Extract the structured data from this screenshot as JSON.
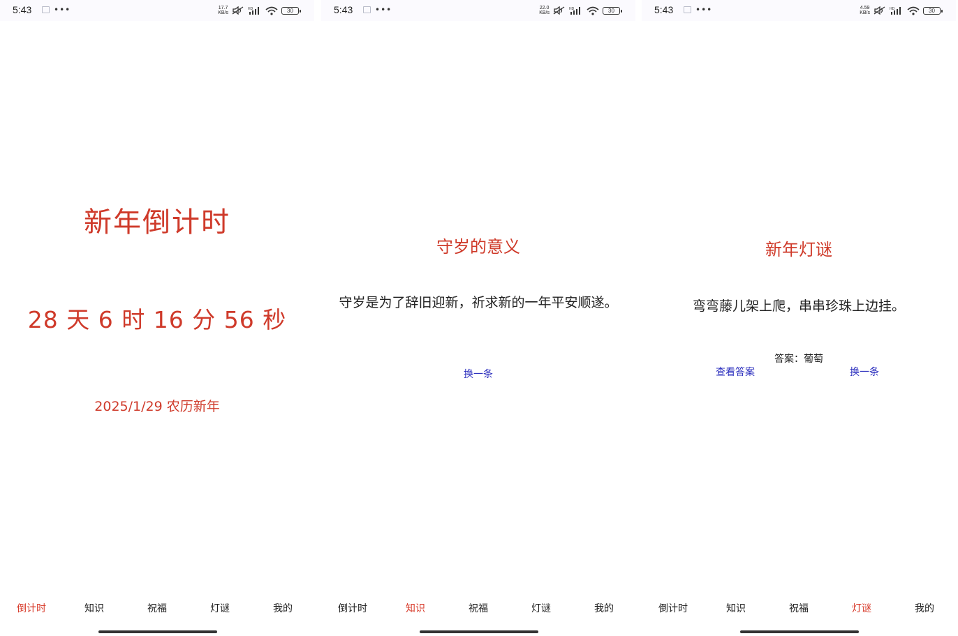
{
  "status": {
    "time": "5:43",
    "speeds": [
      "17.7",
      "22.0",
      "4.59"
    ],
    "speed_unit": "KB/s",
    "hd": "HD",
    "battery": "30"
  },
  "nav_items": [
    "倒计时",
    "知识",
    "祝福",
    "灯谜",
    "我的"
  ],
  "colors": {
    "accent_red": "#cf3a2a",
    "link_blue": "#2a2dbd",
    "nav_active": "#d83b2b"
  },
  "countdown_screen": {
    "title": "新年倒计时",
    "countdown": "28 天 6 时 16 分 56 秒",
    "date": "2025/1/29 农历新年",
    "active_tab": 0
  },
  "knowledge_screen": {
    "title": "守岁的意义",
    "body": "守岁是为了辞旧迎新，祈求新的一年平安顺遂。",
    "change_label": "换一条",
    "active_tab": 1
  },
  "riddle_screen": {
    "title": "新年灯谜",
    "riddle": "弯弯藤儿架上爬，串串珍珠上边挂。",
    "answer": "答案：葡萄",
    "show_answer_label": "查看答案",
    "change_label": "换一条",
    "active_tab": 3
  },
  "icons": [
    "sim-icon",
    "more-dots-icon",
    "mute-icon",
    "signal-icon",
    "wifi-icon",
    "battery-icon"
  ]
}
